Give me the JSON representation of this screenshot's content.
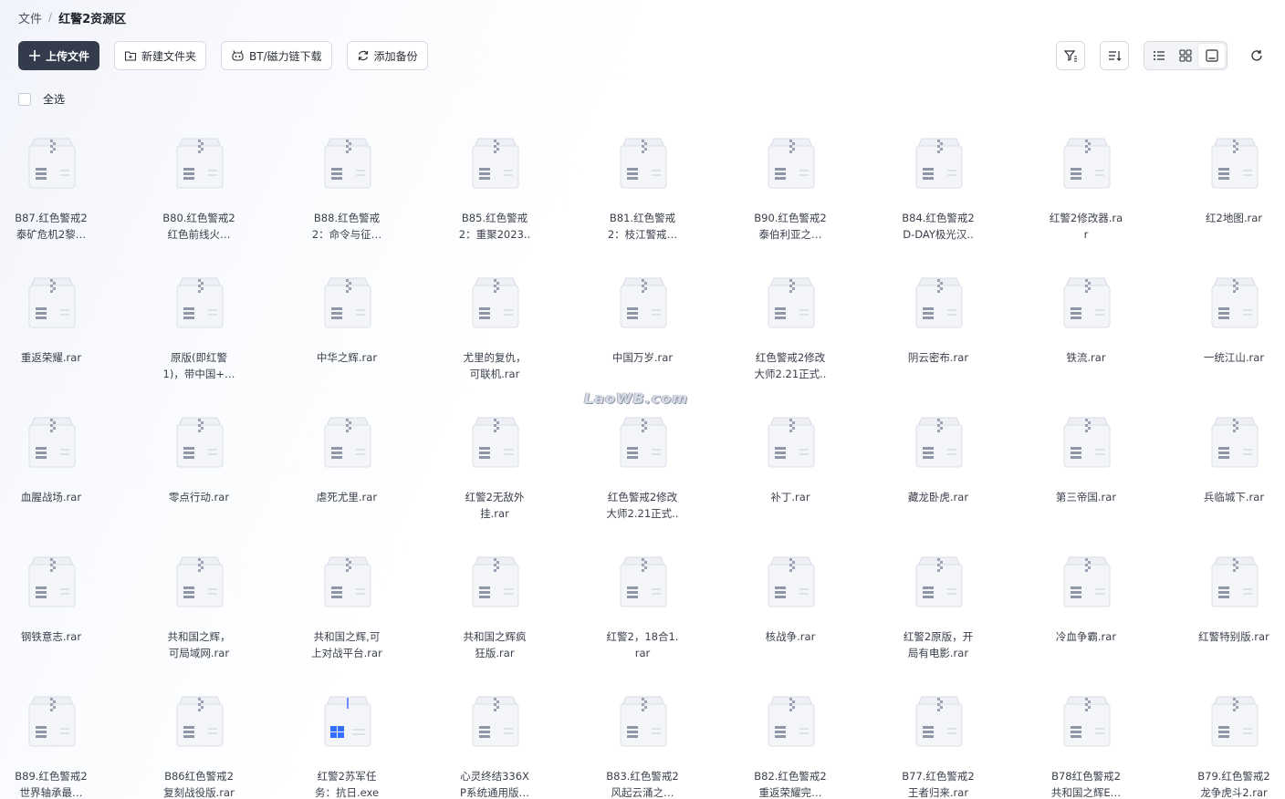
{
  "breadcrumb": {
    "root": "文件",
    "separator": "/",
    "current": "红警2资源区"
  },
  "toolbar": {
    "upload_label": "上传文件",
    "new_folder_label": "新建文件夹",
    "bt_label": "BT/磁力链下载",
    "backup_label": "添加备份"
  },
  "select_all_label": "全选",
  "watermark_text": "LaoWB.com",
  "colors": {
    "primary_button": "#343b4d",
    "app_icon_blue": "#3370ff"
  },
  "files": [
    {
      "name": "B87.红色警戒2\n泰矿危机2黎…",
      "type": "rar"
    },
    {
      "name": "B80.红色警戒2\n红色前线火…",
      "type": "rar"
    },
    {
      "name": "B88.红色警戒\n2：命令与征…",
      "type": "rar"
    },
    {
      "name": "B85.红色警戒\n2：重聚2023..",
      "type": "rar"
    },
    {
      "name": "B81.红色警戒\n2：枝江警戒…",
      "type": "rar"
    },
    {
      "name": "B90.红色警戒2\n泰伯利亚之…",
      "type": "rar"
    },
    {
      "name": "B84.红色警戒2\nD-DAY极光汉..",
      "type": "rar"
    },
    {
      "name": "红警2修改器.ra\nr",
      "type": "rar"
    },
    {
      "name": "红2地图.rar",
      "type": "rar"
    },
    {
      "name": "重返荣耀.rar",
      "type": "rar"
    },
    {
      "name": "原版(即红警\n1)，带中国+…",
      "type": "rar"
    },
    {
      "name": "中华之辉.rar",
      "type": "rar"
    },
    {
      "name": "尤里的复仇，\n可联机.rar",
      "type": "rar"
    },
    {
      "name": "中国万岁.rar",
      "type": "rar"
    },
    {
      "name": "红色警戒2修改\n大师2.21正式..",
      "type": "rar"
    },
    {
      "name": "阴云密布.rar",
      "type": "rar"
    },
    {
      "name": "铁流.rar",
      "type": "rar"
    },
    {
      "name": "一统江山.rar",
      "type": "rar"
    },
    {
      "name": "血腥战场.rar",
      "type": "rar"
    },
    {
      "name": "零点行动.rar",
      "type": "rar"
    },
    {
      "name": "虐死尤里.rar",
      "type": "rar"
    },
    {
      "name": "红警2无敌外\n挂.rar",
      "type": "rar"
    },
    {
      "name": "红色警戒2修改\n大师2.21正式..",
      "type": "rar"
    },
    {
      "name": "补丁.rar",
      "type": "rar"
    },
    {
      "name": "藏龙卧虎.rar",
      "type": "rar"
    },
    {
      "name": "第三帝国.rar",
      "type": "rar"
    },
    {
      "name": "兵临城下.rar",
      "type": "rar"
    },
    {
      "name": "钢铁意志.rar",
      "type": "rar"
    },
    {
      "name": "共和国之辉，\n可局域网.rar",
      "type": "rar"
    },
    {
      "name": "共和国之辉,可\n上对战平台.rar",
      "type": "rar"
    },
    {
      "name": "共和国之辉疯\n狂版.rar",
      "type": "rar"
    },
    {
      "name": "红警2，18合1.\nrar",
      "type": "rar"
    },
    {
      "name": "核战争.rar",
      "type": "rar"
    },
    {
      "name": "红警2原版，开\n局有电影.rar",
      "type": "rar"
    },
    {
      "name": "冷血争霸.rar",
      "type": "rar"
    },
    {
      "name": "红警特别版.rar",
      "type": "rar"
    },
    {
      "name": "B89.红色警戒2\n世界轴承最…",
      "type": "rar"
    },
    {
      "name": "B86红色警戒2\n复刻战役版.rar",
      "type": "rar"
    },
    {
      "name": "红警2苏军任\n务：抗日.exe",
      "type": "exe"
    },
    {
      "name": "心灵终结336X\nP系统通用版…",
      "type": "rar"
    },
    {
      "name": "B83.红色警戒2\n风起云涌之…",
      "type": "rar"
    },
    {
      "name": "B82.红色警戒2\n重返荣耀完…",
      "type": "rar"
    },
    {
      "name": "B77.红色警戒2\n王者归来.rar",
      "type": "rar"
    },
    {
      "name": "B78红色警戒2\n共和国之辉E…",
      "type": "rar"
    },
    {
      "name": "B79.红色警戒2\n龙争虎斗2.rar",
      "type": "rar"
    }
  ]
}
